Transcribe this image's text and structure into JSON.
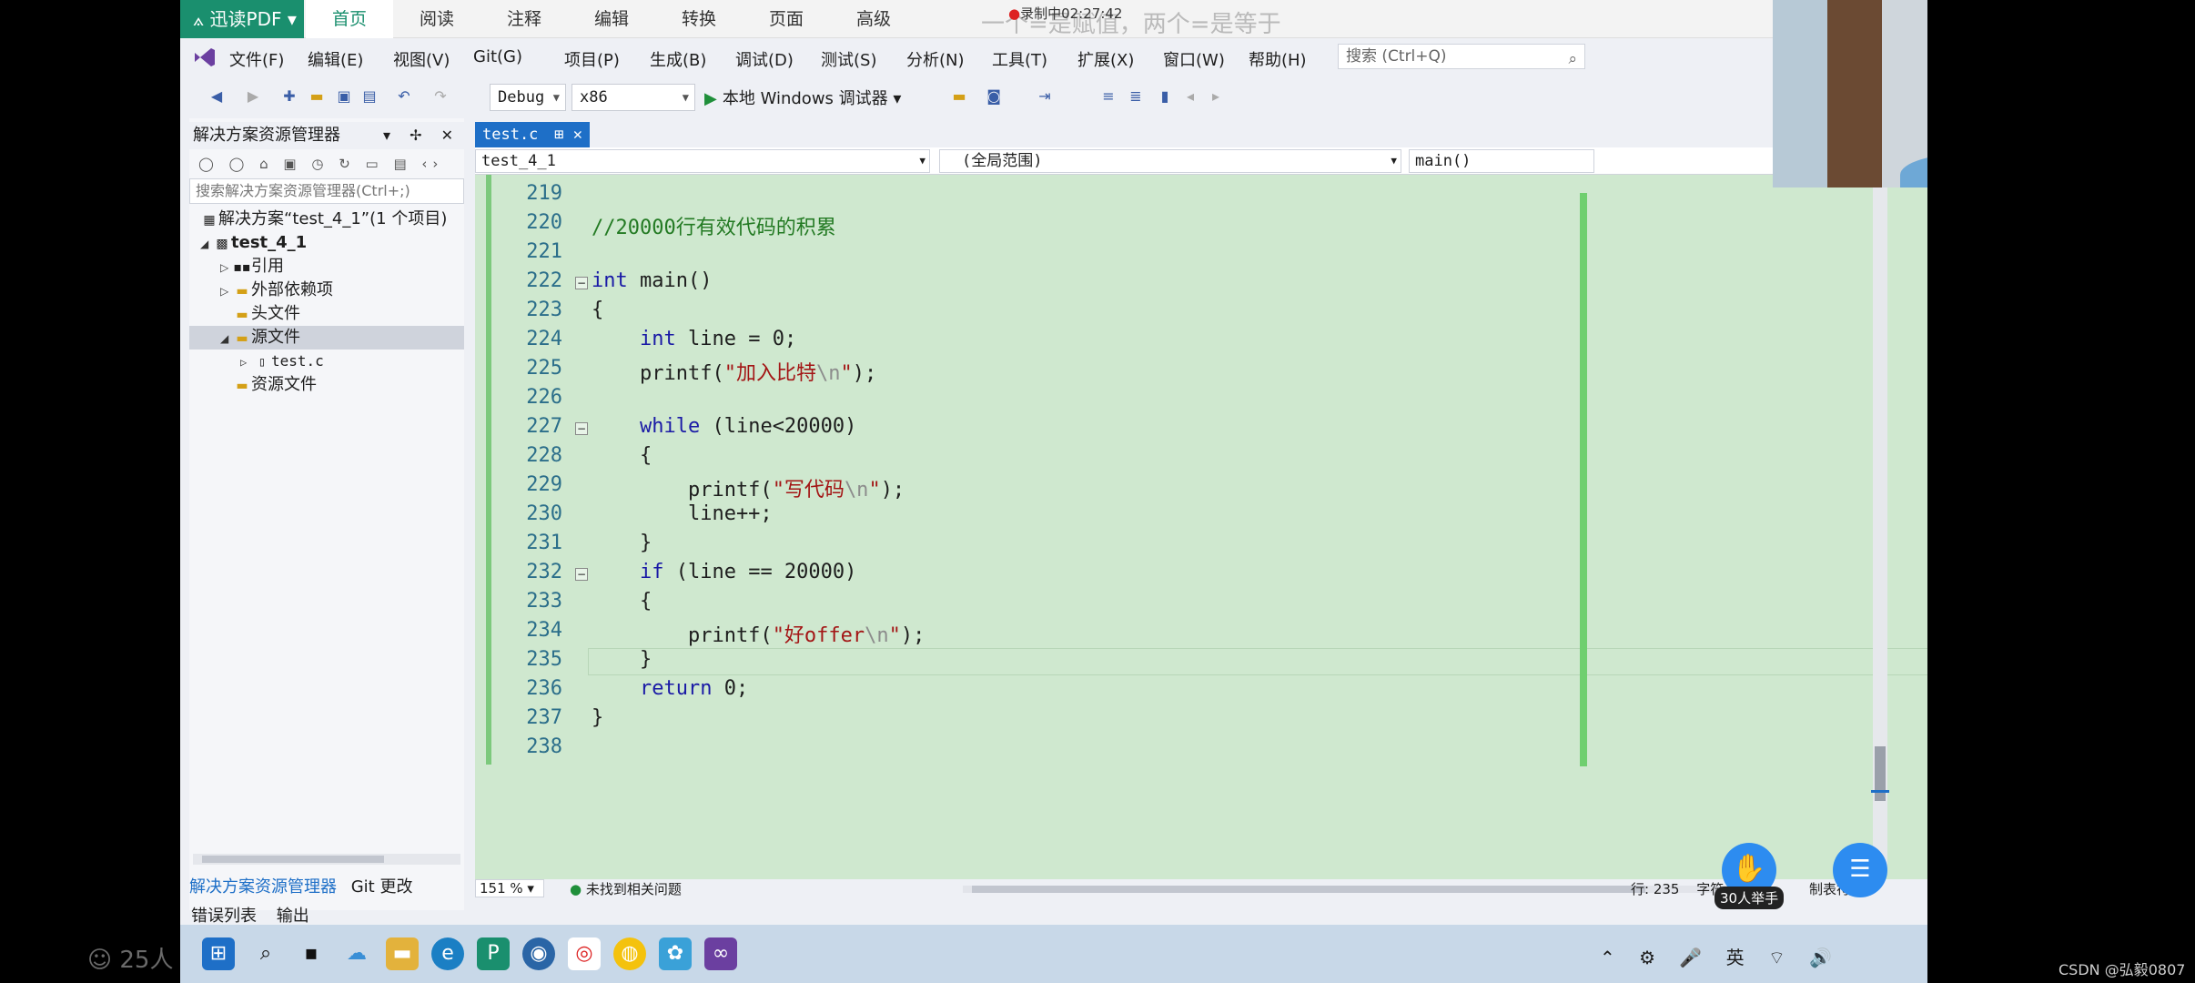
{
  "pdf_reader": {
    "app_name": "迅读PDF",
    "tabs": [
      "首页",
      "阅读",
      "注释",
      "编辑",
      "转换",
      "页面",
      "高级"
    ],
    "active_tab": "首页",
    "recording": "录制中02:27:42",
    "banner": "一个=是赋值，两个=是等于"
  },
  "menu": {
    "items": [
      "文件(F)",
      "编辑(E)",
      "视图(V)",
      "Git(G)",
      "项目(P)",
      "生成(B)",
      "调试(D)",
      "测试(S)",
      "分析(N)",
      "工具(T)",
      "扩展(X)",
      "窗口(W)",
      "帮助(H)"
    ],
    "search_placeholder": "搜索 (Ctrl+Q)"
  },
  "toolbar": {
    "config": "Debug",
    "platform": "x86",
    "run_label": "本地 Windows 调试器"
  },
  "solution_explorer": {
    "title": "解决方案资源管理器",
    "search_placeholder": "搜索解决方案资源管理器(Ctrl+;)",
    "items": [
      {
        "label": "解决方案“test_4_1”(1 个项目)",
        "level": 0
      },
      {
        "label": "test_4_1",
        "level": 1
      },
      {
        "label": "引用",
        "level": 2
      },
      {
        "label": "外部依赖项",
        "level": 2
      },
      {
        "label": "头文件",
        "level": 2
      },
      {
        "label": "源文件",
        "level": 2,
        "selected": true
      },
      {
        "label": "test.c",
        "level": 3
      },
      {
        "label": "资源文件",
        "level": 2
      }
    ],
    "bottom_tabs": [
      "解决方案资源管理器",
      "Git 更改"
    ]
  },
  "output_tabs": [
    "错误列表",
    "输出"
  ],
  "editor": {
    "tab_label": "test.c",
    "project_combo": "test_4_1",
    "scope_combo": "(全局范围)",
    "member_combo": "main()",
    "lines": [
      {
        "n": "219",
        "html": ""
      },
      {
        "n": "220",
        "html": "<span class='cm'>//20000行有效代码的积累</span>"
      },
      {
        "n": "221",
        "html": ""
      },
      {
        "n": "222",
        "html": "<span class='kw'>int</span> main()"
      },
      {
        "n": "223",
        "html": "{"
      },
      {
        "n": "224",
        "html": "    <span class='kw'>int</span> line = 0;"
      },
      {
        "n": "225",
        "html": "    printf(<span class='str'>\"加入比特<span class='esc'>\\n</span>\"</span>);"
      },
      {
        "n": "226",
        "html": ""
      },
      {
        "n": "227",
        "html": "    <span class='kw'>while</span> (line&lt;20000)"
      },
      {
        "n": "228",
        "html": "    {"
      },
      {
        "n": "229",
        "html": "        printf(<span class='str'>\"写代码<span class='esc'>\\n</span>\"</span>);"
      },
      {
        "n": "230",
        "html": "        line++;"
      },
      {
        "n": "231",
        "html": "    }"
      },
      {
        "n": "232",
        "html": "    <span class='kw'>if</span> (line == 20000)"
      },
      {
        "n": "233",
        "html": "    {"
      },
      {
        "n": "234",
        "html": "        printf(<span class='str'>\"好offer<span class='esc'>\\n</span>\"</span>);"
      },
      {
        "n": "235",
        "html": "    }"
      },
      {
        "n": "236",
        "html": "    <span class='kw'>return</span> 0;"
      },
      {
        "n": "237",
        "html": "}"
      },
      {
        "n": "238",
        "html": ""
      }
    ],
    "zoom": "151 %",
    "status_ok": "未找到相关问题",
    "position": "行: 235",
    "char": "字符: 5",
    "tab_mode": "制表符"
  },
  "overlay": {
    "hand_label": "30人举手",
    "viewers": "25人",
    "watermark": "CSDN @弘毅0807"
  }
}
